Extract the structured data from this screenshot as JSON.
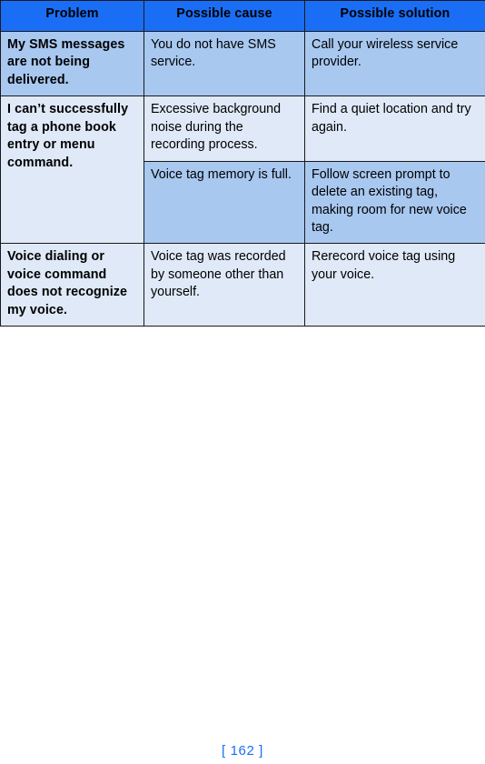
{
  "table": {
    "headers": [
      "Problem",
      "Possible cause",
      "Possible solution"
    ],
    "rows": [
      {
        "problem": "My SMS messages are not being delivered.",
        "entries": [
          {
            "cause": "You do not have SMS service.",
            "solution": "Call your wireless service provider."
          }
        ]
      },
      {
        "problem": "I can’t successfully tag a phone book entry or menu command.",
        "entries": [
          {
            "cause": "Excessive background noise during the recording process.",
            "solution": "Find a quiet location and try again."
          },
          {
            "cause": "Voice tag memory is full.",
            "solution": "Follow screen prompt to delete an existing tag, making room for new voice tag."
          }
        ]
      },
      {
        "problem": "Voice dialing or voice command does not recognize my voice.",
        "entries": [
          {
            "cause": "Voice tag was recorded by someone other than yourself.",
            "solution": "Rerecord voice tag using your voice."
          }
        ]
      }
    ]
  },
  "footer": {
    "page_label": "[ 162 ]"
  },
  "colors": {
    "header_blue": "#1a6ef5",
    "cell_medium_blue": "#a8c8f0",
    "cell_light_blue": "#dfe9f7",
    "border": "#1a1a1a",
    "footer_blue": "#1a6ef5"
  }
}
